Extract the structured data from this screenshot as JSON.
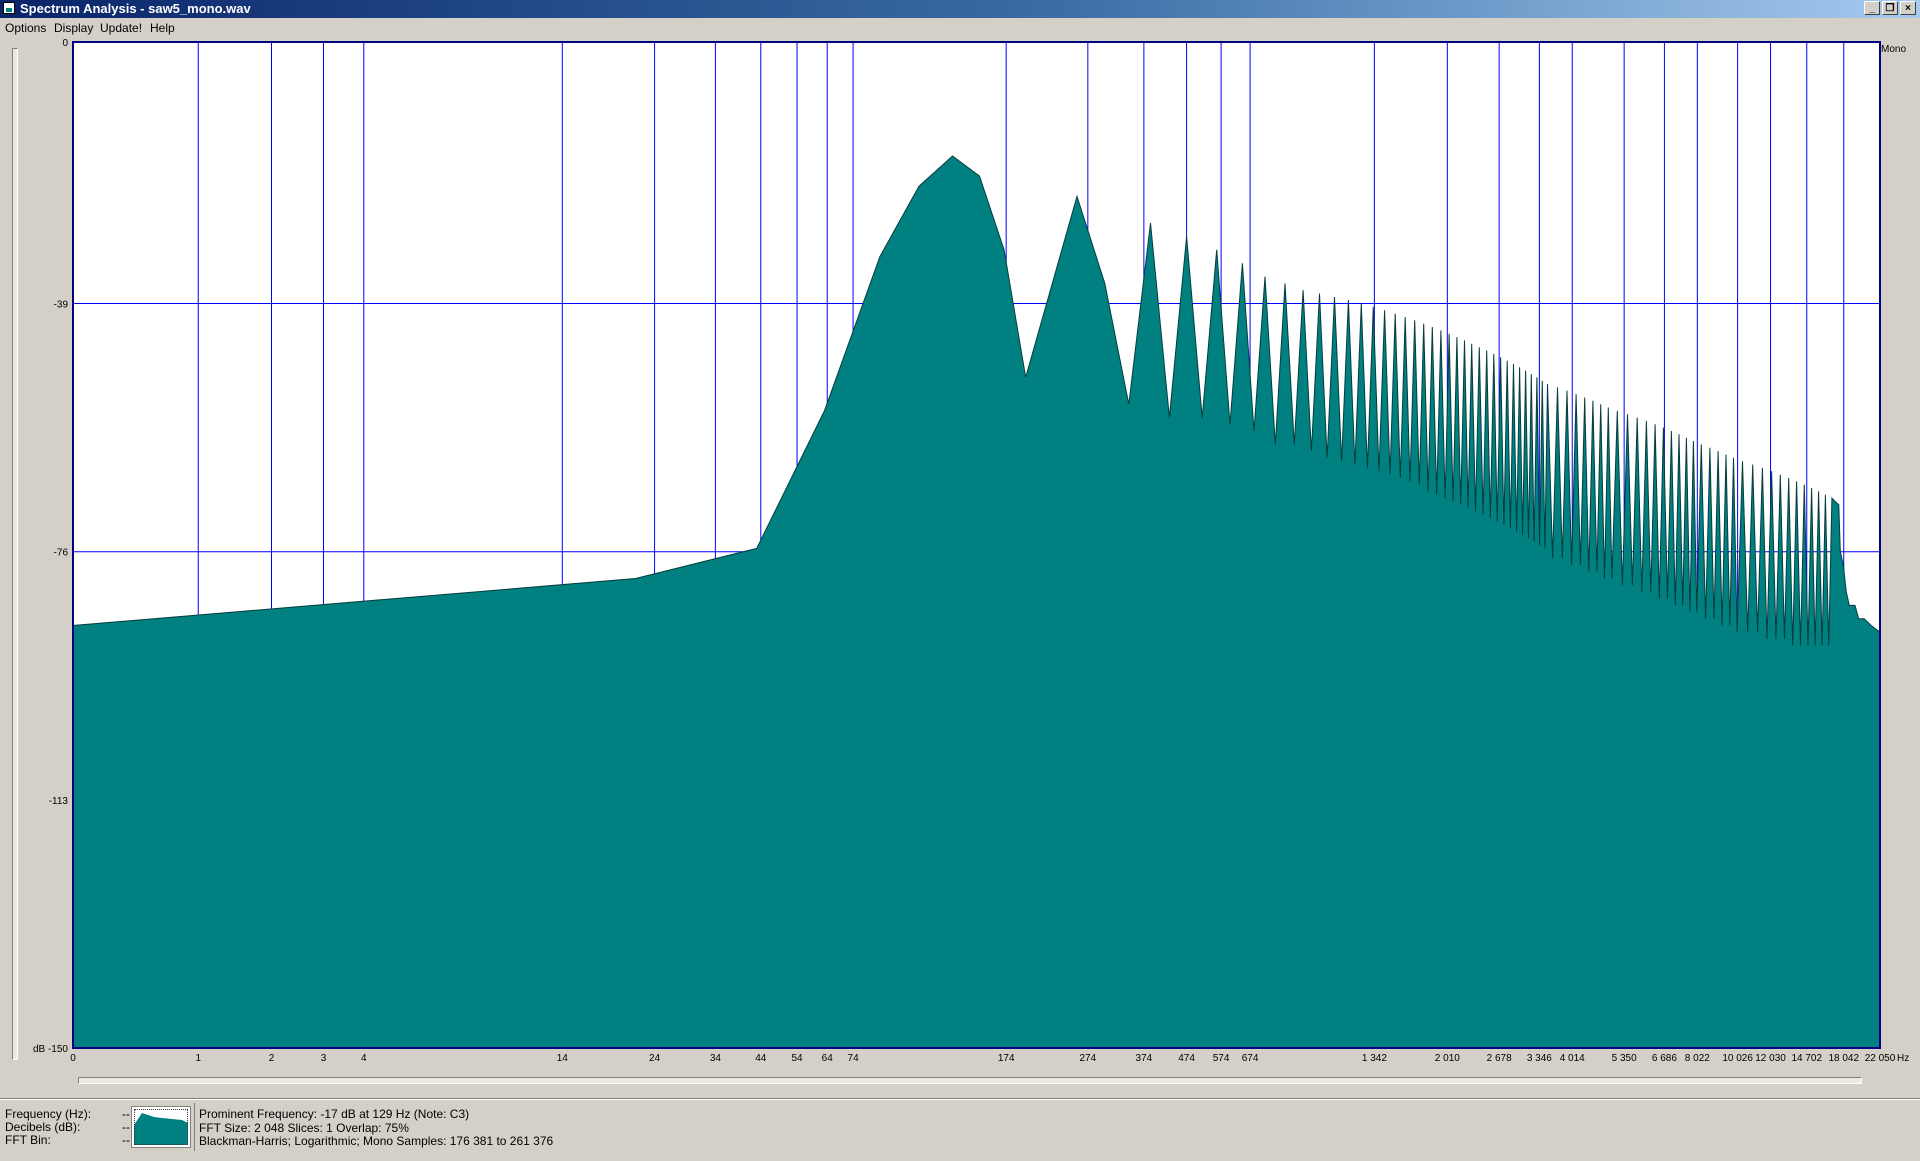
{
  "window": {
    "title": "Spectrum Analysis - saw5_mono.wav",
    "buttons": {
      "minimize": "_",
      "restore": "❐",
      "close": "×"
    }
  },
  "menu": [
    {
      "label": "Options"
    },
    {
      "label": "Display"
    },
    {
      "label": "Update!"
    },
    {
      "label": "Help"
    }
  ],
  "colors": {
    "fill": "#008080",
    "grid": "#0000ff",
    "plot_bg": "#ffffff",
    "window_bg": "#d4d0c8"
  },
  "chart_data": {
    "type": "area",
    "channel_label": "Mono",
    "x_unit": "Hz",
    "y_unit": "dB",
    "x_scale": "log",
    "ylim": [
      -150,
      0
    ],
    "y_ticks": [
      "0",
      "-39",
      "-76",
      "-113",
      "dB -150"
    ],
    "y_tick_values": [
      0,
      -39,
      -76,
      -113,
      -150
    ],
    "x_ticks": [
      "0",
      "1",
      "2",
      "3",
      "4",
      "14",
      "24",
      "34",
      "44",
      "54",
      "64",
      "74",
      "174",
      "274",
      "374",
      "474",
      "574",
      "674",
      "1 342",
      "2 010",
      "2 678",
      "3 346",
      "4 014",
      "5 350",
      "6 686",
      "8 022",
      "10 026",
      "12 030",
      "14 702",
      "18 042",
      "22 050"
    ],
    "x_tick_values": [
      0,
      1,
      2,
      3,
      4,
      14,
      24,
      34,
      44,
      54,
      64,
      74,
      174,
      274,
      374,
      474,
      574,
      674,
      1342,
      2010,
      2678,
      3346,
      4014,
      5350,
      6686,
      8022,
      10026,
      12030,
      14702,
      18042,
      22050
    ],
    "grid": true,
    "series": [
      {
        "points": [
          [
            0,
            -87
          ],
          [
            21.5,
            -80
          ],
          [
            43,
            -75.5
          ],
          [
            63,
            -55
          ],
          [
            86,
            -32
          ],
          [
            107,
            -21.5
          ],
          [
            129,
            -17
          ],
          [
            150,
            -20
          ],
          [
            172,
            -31
          ],
          [
            194,
            -50
          ],
          [
            258,
            -23
          ],
          [
            301,
            -36
          ],
          [
            344,
            -54
          ],
          [
            388,
            -27
          ],
          [
            431,
            -56
          ],
          [
            474,
            -29
          ],
          [
            517,
            -56
          ],
          [
            560,
            -31
          ],
          [
            603,
            -57
          ],
          [
            646,
            -33
          ],
          [
            689,
            -58
          ],
          [
            732,
            -35
          ],
          [
            775,
            -60
          ],
          [
            818,
            -36
          ],
          [
            861,
            -60
          ],
          [
            904,
            -37
          ],
          [
            947,
            -61
          ],
          [
            990,
            -37.5
          ],
          [
            1033,
            -62
          ],
          [
            1076,
            -38
          ],
          [
            1119,
            -62.5
          ],
          [
            1162,
            -38.5
          ],
          [
            1205,
            -63
          ],
          [
            1248,
            -39
          ],
          [
            1291,
            -63.5
          ],
          [
            1334,
            -39.5
          ],
          [
            1377,
            -64
          ],
          [
            1420,
            -40
          ],
          [
            1463,
            -64.5
          ],
          [
            1506,
            -40.5
          ],
          [
            1549,
            -65
          ],
          [
            1592,
            -41
          ],
          [
            1635,
            -65.5
          ],
          [
            1678,
            -41.5
          ],
          [
            1721,
            -66
          ],
          [
            1764,
            -42
          ],
          [
            1807,
            -67
          ],
          [
            1850,
            -42.5
          ],
          [
            1895,
            -67.5
          ],
          [
            1940,
            -43
          ],
          [
            1985,
            -68
          ],
          [
            2030,
            -43.5
          ],
          [
            2075,
            -68.5
          ],
          [
            2120,
            -44
          ],
          [
            2165,
            -69
          ],
          [
            2210,
            -44.5
          ],
          [
            2255,
            -69.5
          ],
          [
            2300,
            -45
          ],
          [
            2350,
            -70
          ],
          [
            2400,
            -45.5
          ],
          [
            2450,
            -70.5
          ],
          [
            2500,
            -46
          ],
          [
            2550,
            -71
          ],
          [
            2600,
            -46.5
          ],
          [
            2650,
            -71.5
          ],
          [
            2700,
            -47
          ],
          [
            2750,
            -72
          ],
          [
            2800,
            -47.5
          ],
          [
            2850,
            -72.5
          ],
          [
            2900,
            -48
          ],
          [
            2950,
            -73
          ],
          [
            3000,
            -48.5
          ],
          [
            3050,
            -73.5
          ],
          [
            3100,
            -49
          ],
          [
            3150,
            -74
          ],
          [
            3200,
            -49.5
          ],
          [
            3250,
            -74.5
          ],
          [
            3300,
            -50
          ],
          [
            3350,
            -75
          ],
          [
            3400,
            -50.5
          ],
          [
            3450,
            -75.5
          ],
          [
            3500,
            -51
          ],
          [
            3600,
            -77
          ],
          [
            3700,
            -51.5
          ],
          [
            3800,
            -77
          ],
          [
            3900,
            -52
          ],
          [
            4000,
            -78
          ],
          [
            4100,
            -52.5
          ],
          [
            4200,
            -78
          ],
          [
            4300,
            -53
          ],
          [
            4400,
            -79
          ],
          [
            4500,
            -53.5
          ],
          [
            4600,
            -79
          ],
          [
            4700,
            -54
          ],
          [
            4800,
            -80
          ],
          [
            4900,
            -54.5
          ],
          [
            5000,
            -80
          ],
          [
            5150,
            -55
          ],
          [
            5300,
            -81
          ],
          [
            5450,
            -55.5
          ],
          [
            5600,
            -81
          ],
          [
            5750,
            -56
          ],
          [
            5900,
            -82
          ],
          [
            6050,
            -56.5
          ],
          [
            6200,
            -82
          ],
          [
            6350,
            -57
          ],
          [
            6500,
            -83
          ],
          [
            6650,
            -57.5
          ],
          [
            6800,
            -83
          ],
          [
            6950,
            -58
          ],
          [
            7100,
            -84
          ],
          [
            7250,
            -58.5
          ],
          [
            7400,
            -84
          ],
          [
            7550,
            -59
          ],
          [
            7700,
            -85
          ],
          [
            7850,
            -59.5
          ],
          [
            8000,
            -85
          ],
          [
            8200,
            -60
          ],
          [
            8400,
            -86
          ],
          [
            8600,
            -60.5
          ],
          [
            8800,
            -86
          ],
          [
            9000,
            -61
          ],
          [
            9200,
            -87
          ],
          [
            9400,
            -61.5
          ],
          [
            9600,
            -87
          ],
          [
            9800,
            -62
          ],
          [
            10000,
            -88
          ],
          [
            10300,
            -62.5
          ],
          [
            10600,
            -88
          ],
          [
            10900,
            -63
          ],
          [
            11200,
            -88
          ],
          [
            11500,
            -63.5
          ],
          [
            11800,
            -89
          ],
          [
            12100,
            -64
          ],
          [
            12400,
            -89
          ],
          [
            12700,
            -64.5
          ],
          [
            13000,
            -89
          ],
          [
            13300,
            -65
          ],
          [
            13600,
            -90
          ],
          [
            13900,
            -65.5
          ],
          [
            14200,
            -90
          ],
          [
            14500,
            -66
          ],
          [
            14800,
            -90
          ],
          [
            15100,
            -66.5
          ],
          [
            15400,
            -90
          ],
          [
            15700,
            -67
          ],
          [
            16000,
            -90
          ],
          [
            16300,
            -67.5
          ],
          [
            16600,
            -90
          ],
          [
            16900,
            -68
          ],
          [
            17200,
            -68.5
          ],
          [
            17550,
            -69
          ],
          [
            17700,
            -76
          ],
          [
            18000,
            -78
          ],
          [
            18300,
            -82
          ],
          [
            18600,
            -84
          ],
          [
            19200,
            -84
          ],
          [
            19600,
            -86
          ],
          [
            20200,
            -86
          ],
          [
            21000,
            -87
          ],
          [
            22050,
            -88
          ]
        ]
      }
    ]
  },
  "status": {
    "labels": [
      {
        "label": "Frequency (Hz):",
        "value": "--"
      },
      {
        "label": "Decibels (dB):",
        "value": "--"
      },
      {
        "label": "FFT Bin:",
        "value": "--"
      }
    ],
    "prominent": "Prominent Frequency: -17 dB at 129 Hz (Note: C3)",
    "fft": "FFT Size: 2 048  Slices: 1  Overlap: 75%",
    "window": "Blackman-Harris; Logarithmic; Mono  Samples: 176 381 to 261 376"
  }
}
